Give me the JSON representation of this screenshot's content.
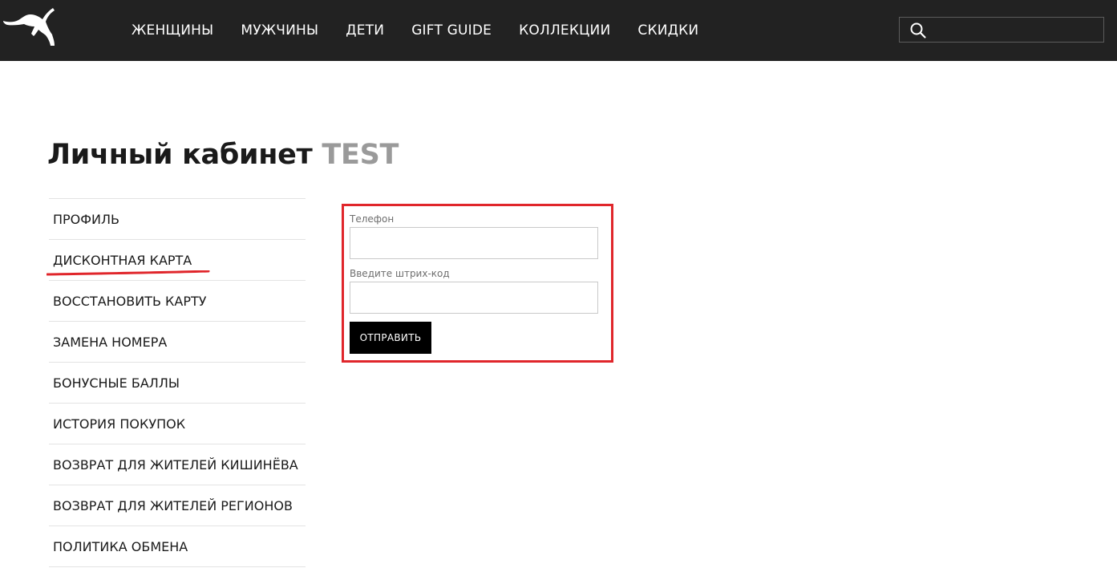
{
  "header": {
    "logo_icon": "puma-cat-logo-icon",
    "nav": [
      {
        "label": "ЖЕНЩИНЫ"
      },
      {
        "label": "МУЖЧИНЫ"
      },
      {
        "label": "ДЕТИ"
      },
      {
        "label": "GIFT GUIDE"
      },
      {
        "label": "КОЛЛЕКЦИИ"
      },
      {
        "label": "СКИДКИ"
      }
    ],
    "search": {
      "icon": "search-icon",
      "placeholder": "",
      "value": ""
    }
  },
  "page": {
    "title": "Личный кабинет",
    "user_name": "TEST"
  },
  "sidebar": {
    "items": [
      {
        "label": "ПРОФИЛЬ"
      },
      {
        "label": "ДИСКОНТНАЯ КАРТА",
        "active": true
      },
      {
        "label": "ВОССТАНОВИТЬ КАРТУ"
      },
      {
        "label": "ЗАМЕНА НОМЕРА"
      },
      {
        "label": "БОНУСНЫЕ БАЛЛЫ"
      },
      {
        "label": "ИСТОРИЯ ПОКУПОК"
      },
      {
        "label": "ВОЗВРАТ ДЛЯ ЖИТЕЛЕЙ КИШИНЁВА"
      },
      {
        "label": "ВОЗВРАТ ДЛЯ ЖИТЕЛЕЙ РЕГИОНОВ"
      },
      {
        "label": "ПОЛИТИКА ОБМЕНА"
      }
    ]
  },
  "form": {
    "phone_label": "Телефон",
    "phone_value": "",
    "barcode_label": "Введите штрих-код",
    "barcode_value": "",
    "submit_label": "ОТПРАВИТЬ"
  },
  "colors": {
    "header_bg": "#222222",
    "highlight": "#e0262b",
    "button_bg": "#000000",
    "title_name": "#9a9a9a"
  }
}
